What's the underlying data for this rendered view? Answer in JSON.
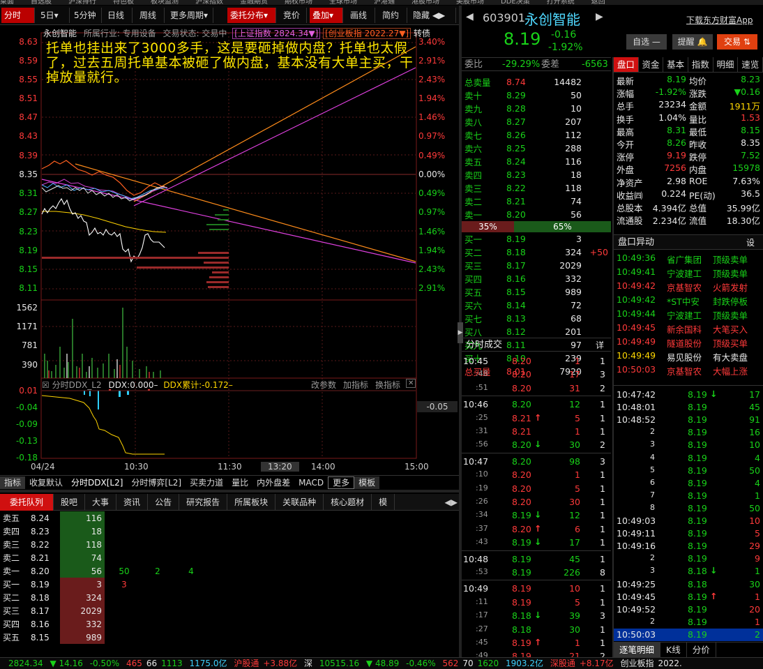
{
  "topmenu": [
    "桌面",
    "自选股",
    "沪深排行",
    "特色板",
    "板块监测",
    "沪深指数",
    "金融期货",
    "期权市场",
    "全球市场",
    "沪港通",
    "港股市场",
    "美股市场",
    "DDE决策",
    "打开系统",
    "返回"
  ],
  "toolbar": {
    "left_tabs": [
      "分时",
      "5日",
      "5分钟",
      "日线",
      "周线",
      "更多周期"
    ],
    "right_tabs": [
      "委托分布",
      "竞价",
      "叠加",
      "画线",
      "简约",
      "隐藏"
    ]
  },
  "chart_header": {
    "stock": "永创智能",
    "industry": "所属行业: 专用设备",
    "state": "交易状态: 交易中",
    "index1": "[上证指数 2824.34▼]",
    "index2": "[创业板指 2022.27▼]",
    "tag": "转债"
  },
  "annotation": "托单也挂出来了3000多手，这是要砸掉做内盘？托单也太假了，过去五周托单基本被砸了做内盘，基本没有大单主买，干掉放量就行。",
  "price_axis": [
    "8.63",
    "8.59",
    "8.55",
    "8.51",
    "8.47",
    "8.43",
    "8.39",
    "8.35",
    "8.31",
    "8.27",
    "8.23",
    "8.19",
    "8.15",
    "8.11"
  ],
  "pct_axis": [
    "3.40%",
    "2.91%",
    "2.43%",
    "1.94%",
    "1.46%",
    "0.97%",
    "0.49%",
    "0.00%",
    "0.49%",
    "0.97%",
    "1.46%",
    "1.94%",
    "2.43%",
    "2.91%"
  ],
  "vol_axis": [
    "1562",
    "1171",
    "781",
    "390"
  ],
  "ddx": {
    "header": "分时DDX_L2",
    "value": "DDX:0.000–",
    "cum": "DDX累计:-0.172–",
    "actions": [
      "改参数",
      "加指标",
      "换指标"
    ],
    "axis": [
      "0.01",
      "-0.04",
      "-0.09",
      "-0.13",
      "-0.18"
    ],
    "right_val": "-0.05"
  },
  "time_axis": [
    "04/24",
    "10:30",
    "11:30",
    "13:20",
    "14:00",
    "15:00"
  ],
  "indicator_tabs": [
    "指标",
    "收复默认",
    "分时DDX[L2]",
    "分时博弈[L2]",
    "买卖力道",
    "量比",
    "内外盘差",
    "MACD",
    "更多",
    "模板"
  ],
  "bottom_tabs": [
    "委托队列",
    "股吧",
    "大事",
    "资讯",
    "公告",
    "研究报告",
    "所属板块",
    "关联品种",
    "核心题材",
    "模"
  ],
  "order_queue": [
    {
      "label": "卖五",
      "price": "8.24",
      "vol": "116",
      "extra": []
    },
    {
      "label": "卖四",
      "price": "8.23",
      "vol": "18",
      "extra": []
    },
    {
      "label": "卖三",
      "price": "8.22",
      "vol": "118",
      "extra": []
    },
    {
      "label": "卖二",
      "price": "8.21",
      "vol": "74",
      "extra": []
    },
    {
      "label": "卖一",
      "price": "8.20",
      "vol": "56",
      "extra": [
        "50",
        "2",
        "4"
      ]
    },
    {
      "label": "买一",
      "price": "8.19",
      "vol": "3",
      "extra": [
        "3"
      ]
    },
    {
      "label": "买二",
      "price": "8.18",
      "vol": "324",
      "extra": []
    },
    {
      "label": "买三",
      "price": "8.17",
      "vol": "2029",
      "extra": []
    },
    {
      "label": "买四",
      "price": "8.16",
      "vol": "332",
      "extra": []
    },
    {
      "label": "买五",
      "price": "8.15",
      "vol": "989",
      "extra": []
    }
  ],
  "quote": {
    "code": "603901",
    "name": "永创智能",
    "download": "下载东方财富App",
    "price": "8.19",
    "change": "-0.16",
    "pct": "-1.92%",
    "btn_watch": "自选 —",
    "btn_alert": "提醒",
    "btn_trade": "交易",
    "weibi_label": "委比",
    "weibi": "-29.29%",
    "weicha_label": "委差",
    "weicha": "-6563",
    "sell_total": {
      "label": "总卖量",
      "price": "8.74",
      "vol": "14482"
    },
    "sells": [
      {
        "label": "卖十",
        "price": "8.29",
        "vol": "50"
      },
      {
        "label": "卖九",
        "price": "8.28",
        "vol": "10"
      },
      {
        "label": "卖八",
        "price": "8.27",
        "vol": "207"
      },
      {
        "label": "卖七",
        "price": "8.26",
        "vol": "112"
      },
      {
        "label": "卖六",
        "price": "8.25",
        "vol": "288"
      },
      {
        "label": "卖五",
        "price": "8.24",
        "vol": "116"
      },
      {
        "label": "卖四",
        "price": "8.23",
        "vol": "18"
      },
      {
        "label": "卖三",
        "price": "8.22",
        "vol": "118"
      },
      {
        "label": "卖二",
        "price": "8.21",
        "vol": "74"
      },
      {
        "label": "卖一",
        "price": "8.20",
        "vol": "56"
      }
    ],
    "ratio_buy": "35%",
    "ratio_sell": "65%",
    "buys": [
      {
        "label": "买一",
        "price": "8.19",
        "vol": "3",
        "chg": ""
      },
      {
        "label": "买二",
        "price": "8.18",
        "vol": "324",
        "chg": "+50"
      },
      {
        "label": "买三",
        "price": "8.17",
        "vol": "2029",
        "chg": ""
      },
      {
        "label": "买四",
        "price": "8.16",
        "vol": "332",
        "chg": ""
      },
      {
        "label": "买五",
        "price": "8.15",
        "vol": "989",
        "chg": ""
      },
      {
        "label": "买六",
        "price": "8.14",
        "vol": "72",
        "chg": ""
      },
      {
        "label": "买七",
        "price": "8.13",
        "vol": "68",
        "chg": ""
      },
      {
        "label": "买八",
        "price": "8.12",
        "vol": "201",
        "chg": ""
      },
      {
        "label": "买九",
        "price": "8.11",
        "vol": "97",
        "chg": ""
      },
      {
        "label": "买十",
        "price": "8.10",
        "vol": "239",
        "chg": ""
      }
    ],
    "buy_total": {
      "label": "总买量",
      "price": "8.01",
      "vol": "7920"
    }
  },
  "trades_title": "分时成交",
  "trades_more": "详",
  "trades": [
    {
      "t": "10:45",
      "p": "8.20",
      "v": "1",
      "n": "1",
      "c": "red",
      "a": ""
    },
    {
      "t": ":48",
      "p": "8.20",
      "v": "17",
      "n": "3",
      "c": "red",
      "a": ""
    },
    {
      "t": ":51",
      "p": "8.20",
      "v": "31",
      "n": "2",
      "c": "red",
      "a": ""
    },
    {
      "t": "10:46",
      "p": "8.20",
      "v": "12",
      "n": "1",
      "c": "grn",
      "a": ""
    },
    {
      "t": ":25",
      "p": "8.21",
      "v": "5",
      "n": "1",
      "c": "red",
      "a": "↑"
    },
    {
      "t": ":31",
      "p": "8.21",
      "v": "1",
      "n": "1",
      "c": "red",
      "a": ""
    },
    {
      "t": ":56",
      "p": "8.20",
      "v": "30",
      "n": "2",
      "c": "grn",
      "a": "↓"
    },
    {
      "t": "10:47",
      "p": "8.20",
      "v": "98",
      "n": "3",
      "c": "grn",
      "a": ""
    },
    {
      "t": ":10",
      "p": "8.20",
      "v": "1",
      "n": "1",
      "c": "red",
      "a": ""
    },
    {
      "t": ":19",
      "p": "8.20",
      "v": "5",
      "n": "1",
      "c": "red",
      "a": ""
    },
    {
      "t": ":26",
      "p": "8.20",
      "v": "30",
      "n": "1",
      "c": "red",
      "a": ""
    },
    {
      "t": ":34",
      "p": "8.19",
      "v": "12",
      "n": "1",
      "c": "grn",
      "a": "↓"
    },
    {
      "t": ":37",
      "p": "8.20",
      "v": "6",
      "n": "1",
      "c": "red",
      "a": "↑"
    },
    {
      "t": ":43",
      "p": "8.19",
      "v": "17",
      "n": "1",
      "c": "grn",
      "a": "↓"
    },
    {
      "t": "10:48",
      "p": "8.19",
      "v": "45",
      "n": "1",
      "c": "grn",
      "a": ""
    },
    {
      "t": ":53",
      "p": "8.19",
      "v": "226",
      "n": "8",
      "c": "grn",
      "a": ""
    },
    {
      "t": "10:49",
      "p": "8.19",
      "v": "10",
      "n": "1",
      "c": "red",
      "a": ""
    },
    {
      "t": ":11",
      "p": "8.19",
      "v": "5",
      "n": "1",
      "c": "red",
      "a": ""
    },
    {
      "t": ":17",
      "p": "8.18",
      "v": "39",
      "n": "3",
      "c": "grn",
      "a": "↓"
    },
    {
      "t": ":27",
      "p": "8.18",
      "v": "30",
      "n": "1",
      "c": "grn",
      "a": ""
    },
    {
      "t": ":45",
      "p": "8.19",
      "v": "1",
      "n": "1",
      "c": "red",
      "a": "↑"
    },
    {
      "t": ":49",
      "p": "8.19",
      "v": "21",
      "n": "2",
      "c": "red",
      "a": ""
    }
  ],
  "tabs_right": [
    "盘口",
    "资金",
    "基本",
    "指数",
    "明细",
    "速览"
  ],
  "stats": [
    {
      "l1": "最新",
      "v1": "8.19",
      "c1": "grn",
      "l2": "均价",
      "v2": "8.23",
      "c2": "grn"
    },
    {
      "l1": "涨幅",
      "v1": "-1.92%",
      "c1": "grn",
      "l2": "涨跌",
      "v2": "▼0.16",
      "c2": "grn"
    },
    {
      "l1": "总手",
      "v1": "23234",
      "c1": "wht",
      "l2": "金额",
      "v2": "1911万",
      "c2": "yel"
    },
    {
      "l1": "换手",
      "v1": "1.04%",
      "c1": "wht",
      "l2": "量比",
      "v2": "1.53",
      "c2": "red"
    },
    {
      "l1": "最高",
      "v1": "8.31",
      "c1": "grn",
      "l2": "最低",
      "v2": "8.15",
      "c2": "grn"
    },
    {
      "l1": "今开",
      "v1": "8.26",
      "c1": "grn",
      "l2": "昨收",
      "v2": "8.35",
      "c2": "wht"
    },
    {
      "l1": "涨停",
      "v1": "9.19",
      "c1": "red",
      "l2": "跌停",
      "v2": "7.52",
      "c2": "grn"
    },
    {
      "l1": "外盘",
      "v1": "7256",
      "c1": "red",
      "l2": "内盘",
      "v2": "15978",
      "c2": "grn"
    },
    {
      "l1": "净资产",
      "v1": "2.98",
      "c1": "wht",
      "l2": "ROE",
      "v2": "7.63%",
      "c2": "wht"
    },
    {
      "l1": "收益㈣",
      "v1": "0.224",
      "c1": "wht",
      "l2": "PE(动)",
      "v2": "36.5",
      "c2": "wht"
    },
    {
      "l1": "总股本",
      "v1": "4.394亿",
      "c1": "wht",
      "l2": "总值",
      "v2": "35.99亿",
      "c2": "wht"
    },
    {
      "l1": "流通股",
      "v1": "2.234亿",
      "c1": "wht",
      "l2": "流值",
      "v2": "18.30亿",
      "c2": "wht"
    }
  ],
  "anomaly_title": "盘口异动",
  "anomaly_set": "设",
  "anomalies": [
    {
      "t": "10:49:36",
      "tc": "grn",
      "s": "省广集团",
      "sc": "grn",
      "e": "顶级卖单",
      "ec": "grn"
    },
    {
      "t": "10:49:41",
      "tc": "grn",
      "s": "宁波建工",
      "sc": "grn",
      "e": "顶级卖单",
      "ec": "grn"
    },
    {
      "t": "10:49:42",
      "tc": "red",
      "s": "京基智农",
      "sc": "red",
      "e": "火箭发射",
      "ec": "red"
    },
    {
      "t": "10:49:42",
      "tc": "grn",
      "s": "*ST中安",
      "sc": "grn",
      "e": "封跌停板",
      "ec": "grn"
    },
    {
      "t": "10:49:44",
      "tc": "grn",
      "s": "宁波建工",
      "sc": "grn",
      "e": "顶级卖单",
      "ec": "grn"
    },
    {
      "t": "10:49:45",
      "tc": "red",
      "s": "新余国科",
      "sc": "red",
      "e": "大笔买入",
      "ec": "red"
    },
    {
      "t": "10:49:49",
      "tc": "red",
      "s": "隧道股份",
      "sc": "red",
      "e": "顶级买单",
      "ec": "red"
    },
    {
      "t": "10:49:49",
      "tc": "yel",
      "s": "易见股份",
      "sc": "wht",
      "e": "有大卖盘",
      "ec": "wht"
    },
    {
      "t": "10:50:03",
      "tc": "red",
      "s": "京基智农",
      "sc": "red",
      "e": "大幅上涨",
      "ec": "red"
    }
  ],
  "ticks": [
    {
      "t": "10:47:42",
      "p": "8.19",
      "a": "↓",
      "v": "17",
      "vc": "grn"
    },
    {
      "t": "10:48:01",
      "p": "8.19",
      "a": "",
      "v": "45",
      "vc": "grn"
    },
    {
      "t": "10:48:52",
      "p": "8.19",
      "a": "",
      "v": "91",
      "vc": "grn"
    },
    {
      "t": "2",
      "p": "8.19",
      "a": "",
      "v": "16",
      "vc": "grn"
    },
    {
      "t": "3",
      "p": "8.19",
      "a": "",
      "v": "10",
      "vc": "grn"
    },
    {
      "t": "4",
      "p": "8.19",
      "a": "",
      "v": "4",
      "vc": "grn"
    },
    {
      "t": "5",
      "p": "8.19",
      "a": "",
      "v": "50",
      "vc": "grn"
    },
    {
      "t": "6",
      "p": "8.19",
      "a": "",
      "v": "4",
      "vc": "grn"
    },
    {
      "t": "7",
      "p": "8.19",
      "a": "",
      "v": "1",
      "vc": "grn"
    },
    {
      "t": "8",
      "p": "8.19",
      "a": "",
      "v": "50",
      "vc": "grn"
    },
    {
      "t": "10:49:03",
      "p": "8.19",
      "a": "",
      "v": "10",
      "vc": "red"
    },
    {
      "t": "10:49:11",
      "p": "8.19",
      "a": "",
      "v": "5",
      "vc": "red"
    },
    {
      "t": "10:49:16",
      "p": "8.19",
      "a": "",
      "v": "29",
      "vc": "red"
    },
    {
      "t": "2",
      "p": "8.19",
      "a": "",
      "v": "9",
      "vc": "red"
    },
    {
      "t": "3",
      "p": "8.18",
      "a": "↓",
      "v": "1",
      "vc": "grn"
    },
    {
      "t": "10:49:25",
      "p": "8.18",
      "a": "",
      "v": "30",
      "vc": "grn"
    },
    {
      "t": "10:49:45",
      "p": "8.19",
      "a": "↑",
      "v": "1",
      "vc": "red"
    },
    {
      "t": "10:49:52",
      "p": "8.19",
      "a": "",
      "v": "20",
      "vc": "red"
    },
    {
      "t": "2",
      "p": "8.19",
      "a": "",
      "v": "1",
      "vc": "red"
    },
    {
      "t": "10:50:03",
      "p": "8.19",
      "a": "",
      "v": "2",
      "vc": "grn"
    }
  ],
  "bottom_right_tabs": [
    "逐笔明细",
    "K线",
    "分价"
  ],
  "statusbar": {
    "sh_index": "2824.34",
    "sh_chg": "▼ 14.16",
    "sh_pct": "-0.50%",
    "sh_up": "465",
    "sh_flat": "66",
    "sh_down": "1113",
    "sh_amt": "1175.0亿",
    "hgt_label": "沪股通",
    "hgt_val": "+3.88亿",
    "sz_label": "深",
    "sz_index": "10515.16",
    "sz_chg": "▼ 48.89",
    "sz_pct": "-0.46%",
    "sz_up": "562",
    "sz_flat": "70",
    "sz_down": "1620",
    "sz_amt": "1903.2亿",
    "sgt_label": "深股通",
    "sgt_val": "+8.17亿",
    "cyb_label": "创业板指",
    "cyb_val": "2022."
  }
}
